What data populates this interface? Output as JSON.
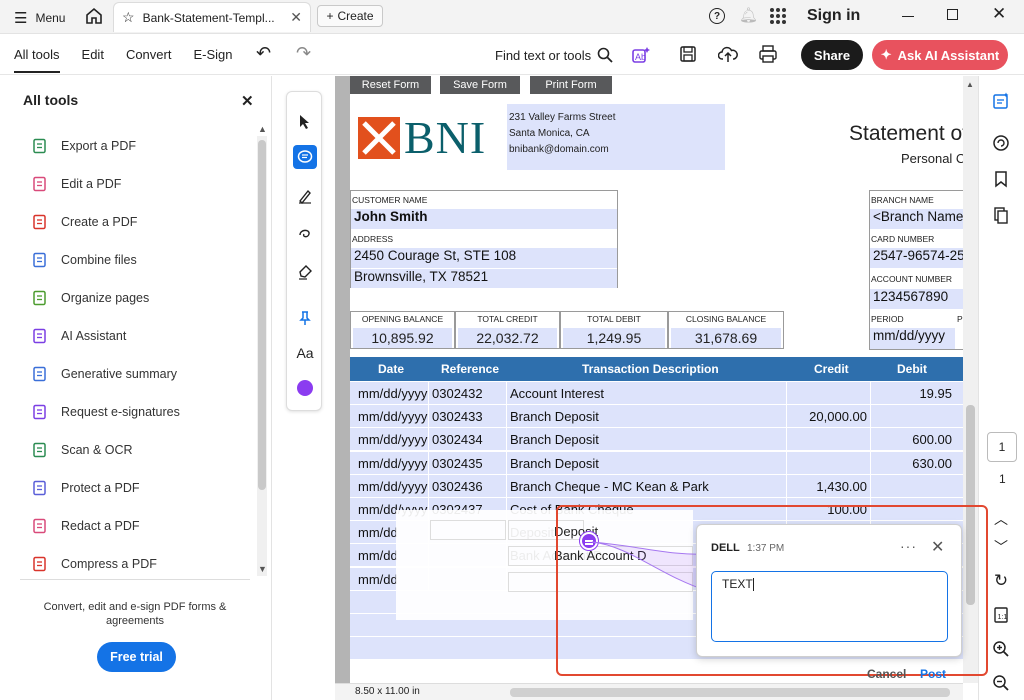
{
  "titlebar": {
    "menu_label": "Menu",
    "tab_title": "Bank-Statement-Templ...",
    "create_label": "Create",
    "signin_label": "Sign in"
  },
  "toolbar": {
    "nav": [
      "All tools",
      "Edit",
      "Convert",
      "E-Sign"
    ],
    "find_label": "Find text or tools",
    "share_label": "Share",
    "ai_label": "Ask AI Assistant"
  },
  "leftpanel": {
    "title": "All tools",
    "tools": [
      {
        "label": "Export a PDF",
        "icon": "export-pdf-icon",
        "color": "#2b8c52"
      },
      {
        "label": "Edit a PDF",
        "icon": "edit-pdf-icon",
        "color": "#d94a7a"
      },
      {
        "label": "Create a PDF",
        "icon": "create-pdf-icon",
        "color": "#d9342b"
      },
      {
        "label": "Combine files",
        "icon": "combine-files-icon",
        "color": "#3a6fd8"
      },
      {
        "label": "Organize pages",
        "icon": "organize-pages-icon",
        "color": "#4c9c2e"
      },
      {
        "label": "AI Assistant",
        "icon": "ai-assistant-icon",
        "color": "#7b3fe4"
      },
      {
        "label": "Generative summary",
        "icon": "generative-summary-icon",
        "color": "#3a6fd8"
      },
      {
        "label": "Request e-signatures",
        "icon": "request-esign-icon",
        "color": "#7b3fe4"
      },
      {
        "label": "Scan & OCR",
        "icon": "scan-ocr-icon",
        "color": "#2b8c52"
      },
      {
        "label": "Protect a PDF",
        "icon": "protect-pdf-icon",
        "color": "#5a5fd8"
      },
      {
        "label": "Redact a PDF",
        "icon": "redact-pdf-icon",
        "color": "#d94a7a"
      },
      {
        "label": "Compress a PDF",
        "icon": "compress-pdf-icon",
        "color": "#d9342b"
      }
    ],
    "promo_text": "Convert, edit and e-sign PDF forms & agreements",
    "free_trial_label": "Free trial"
  },
  "form_buttons": [
    "Reset Form",
    "Save Form",
    "Print Form"
  ],
  "statement": {
    "bank_name": "BNI",
    "address_line1": "231 Valley Farms Street",
    "address_line2": "Santa Monica, CA",
    "email": "bnibank@domain.com",
    "title": "Statement of",
    "subtitle": "Personal Cu",
    "customer_name_label": "CUSTOMER NAME",
    "customer_name": "John Smith",
    "address_label": "ADDRESS",
    "address1": "2450 Courage St, STE 108",
    "address2": "Brownsville, TX 78521",
    "branch_name_label": "BRANCH NAME",
    "branch_name": "<Branch Name",
    "card_number_label": "CARD NUMBER",
    "card_number": "2547-96574-25",
    "account_number_label": "ACCOUNT NUMBER",
    "account_number": "1234567890",
    "period_label": "PERIOD",
    "period_label2": "P",
    "period": "mm/dd/yyyy",
    "balances": [
      {
        "label": "OPENING BALANCE",
        "value": "10,895.92"
      },
      {
        "label": "TOTAL CREDIT",
        "value": "22,032.72"
      },
      {
        "label": "TOTAL DEBIT",
        "value": "1,249.95"
      },
      {
        "label": "CLOSING BALANCE",
        "value": "31,678.69"
      }
    ],
    "tx_headers": [
      "Date",
      "Reference",
      "Transaction Description",
      "Credit",
      "Debit"
    ],
    "transactions": [
      {
        "date": "mm/dd/yyyy",
        "ref": "0302432",
        "desc": "Account Interest",
        "credit": "",
        "debit": "19.95"
      },
      {
        "date": "mm/dd/yyyy",
        "ref": "0302433",
        "desc": "Branch Deposit",
        "credit": "20,000.00",
        "debit": ""
      },
      {
        "date": "mm/dd/yyyy",
        "ref": "0302434",
        "desc": "Branch Deposit",
        "credit": "",
        "debit": "600.00"
      },
      {
        "date": "mm/dd/yyyy",
        "ref": "0302435",
        "desc": "Branch Deposit",
        "credit": "",
        "debit": "630.00"
      },
      {
        "date": "mm/dd/yyyy",
        "ref": "0302436",
        "desc": "Branch Cheque - MC Kean & Park",
        "credit": "1,430.00",
        "debit": ""
      },
      {
        "date": "mm/dd/yyyy",
        "ref": "0302437",
        "desc": "Cost of Bank Cheque",
        "credit": "100.00",
        "debit": ""
      },
      {
        "date": "mm/dd",
        "ref": "",
        "desc": "Deposit",
        "credit": "",
        "debit": ""
      },
      {
        "date": "mm/dd",
        "ref": "",
        "desc": "Bank Account D",
        "credit": "",
        "debit": ""
      },
      {
        "date": "mm/dd",
        "ref": "",
        "desc": "",
        "credit": "",
        "debit": ""
      }
    ]
  },
  "comment": {
    "author": "DELL",
    "time": "1:37 PM",
    "text": "TEXT",
    "cancel_label": "Cancel",
    "post_label": "Post"
  },
  "rightrail": {
    "page_current": "1",
    "page_total": "1"
  },
  "bottombar": {
    "page_size": "8.50 x 11.00 in"
  },
  "colors": {
    "accent": "#1473e6",
    "ai_button": "#e8525e",
    "table_header": "#2e6fad",
    "field_highlight": "#dde3fb",
    "annotation_box": "#e24830",
    "bni_orange": "#e2501d",
    "bni_teal": "#0b5f6b"
  }
}
